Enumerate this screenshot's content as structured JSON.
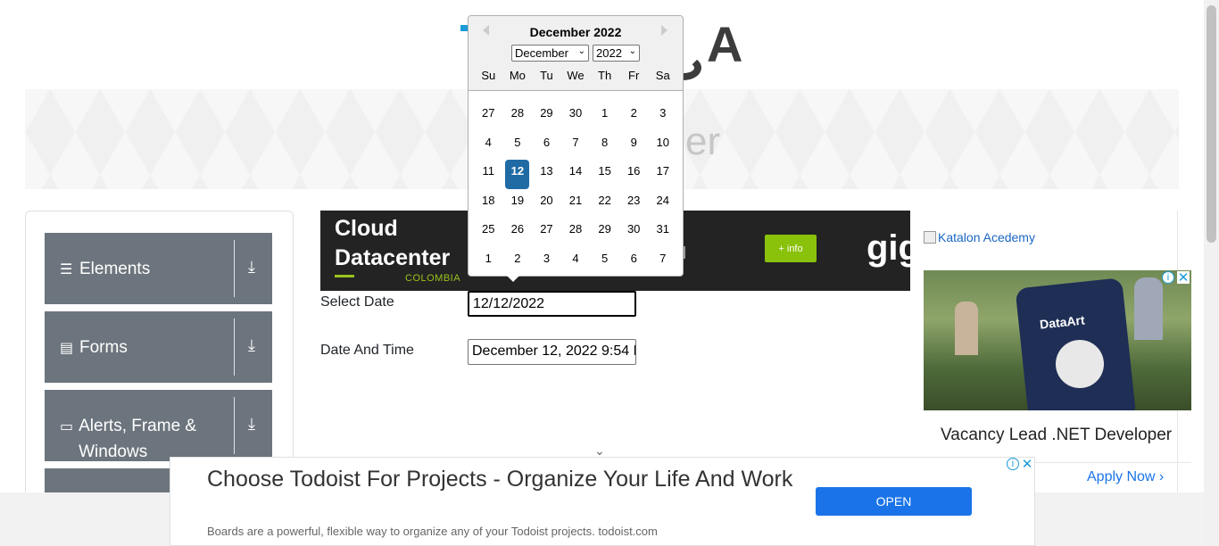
{
  "banner": {
    "title": "er"
  },
  "sidebar": {
    "groups": [
      {
        "label": "Elements",
        "icon": "menu-icon"
      },
      {
        "label": "Forms",
        "icon": "form-icon"
      },
      {
        "label": "Alerts, Frame & Windows",
        "icon": "window-icon"
      }
    ]
  },
  "cloud_ad": {
    "line1": "Cloud",
    "line2": "Datacenter",
    "sub": "COLOMBIA",
    "button": "+ info",
    "brand": "gig"
  },
  "form": {
    "select_date_label": "Select Date",
    "select_date_value": "12/12/2022",
    "date_time_label": "Date And Time",
    "date_time_value": "December 12, 2022 9:54 P"
  },
  "datepicker": {
    "title": "December 2022",
    "month_select": "December",
    "year_select": "2022",
    "day_names": [
      "Su",
      "Mo",
      "Tu",
      "We",
      "Th",
      "Fr",
      "Sa"
    ],
    "weeks": [
      [
        "27",
        "28",
        "29",
        "30",
        "1",
        "2",
        "3"
      ],
      [
        "4",
        "5",
        "6",
        "7",
        "8",
        "9",
        "10"
      ],
      [
        "11",
        "12",
        "13",
        "14",
        "15",
        "16",
        "17"
      ],
      [
        "18",
        "19",
        "20",
        "21",
        "22",
        "23",
        "24"
      ],
      [
        "25",
        "26",
        "27",
        "28",
        "29",
        "30",
        "31"
      ],
      [
        "1",
        "2",
        "3",
        "4",
        "5",
        "6",
        "7"
      ]
    ],
    "selected_day": "12"
  },
  "right_ad": {
    "link": "Katalon Acedemy",
    "photo_text": "DataArt",
    "title": "Vacancy Lead .NET Developer",
    "apply": "Apply Now ›"
  },
  "bottom_ad": {
    "headline": "Choose Todoist For Projects - Organize Your Life And Work",
    "sub": "Boards are a powerful, flexible way to organize any of your Todoist projects. todoist.com",
    "button": "OPEN"
  },
  "colors": {
    "accent": "#216ba5",
    "sidebar": "#6c757d",
    "ad_green": "#8ac10b",
    "open_button": "#1a73e8"
  }
}
